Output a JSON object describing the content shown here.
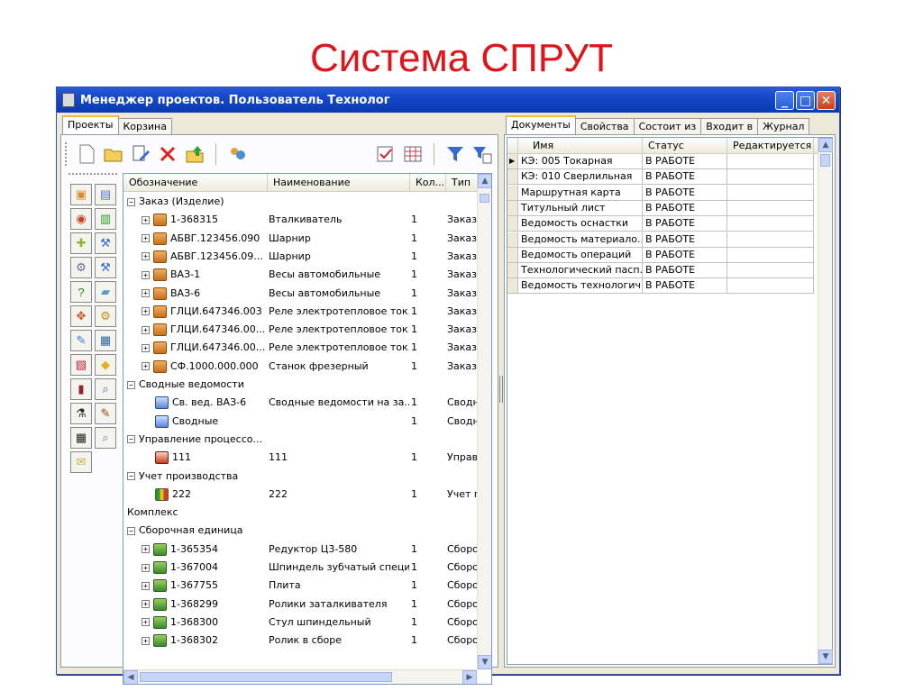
{
  "slide_title": "Система СПРУТ",
  "window": {
    "title": "Менеджер проектов. Пользователь Технолог",
    "buttons": [
      "_",
      "□",
      "✕"
    ]
  },
  "left_tabs": [
    "Проекты",
    "Корзина"
  ],
  "right_tabs": [
    "Документы",
    "Свойства",
    "Состоит из",
    "Входит в",
    "Журнал"
  ],
  "toolbar_icons": [
    "new-icon",
    "open-icon",
    "edit-icon",
    "delete-icon",
    "move-up-icon",
    "users-icon",
    "check-icon",
    "table-icon",
    "filter-icon",
    "filter-settings-icon"
  ],
  "side_icons": [
    "order-icon",
    "summary-icon",
    "process-icon",
    "production-icon",
    "assembly-icon",
    "part-icon",
    "gear-icon",
    "tool-icon",
    "help-icon",
    "material-icon",
    "equipment-icon",
    "settings-icon",
    "edit-doc-icon",
    "machine-icon",
    "report-icon",
    "color-icon",
    "print-icon",
    "view-icon",
    "wizard-icon",
    "paint-icon",
    "database-icon",
    "find-icon",
    "note-icon"
  ],
  "tree_columns": [
    "Обозначение",
    "Наименование",
    "Кол...",
    "Тип"
  ],
  "tree_rows": [
    {
      "level": 0,
      "exp": "⊟",
      "icon": "",
      "name": "Заказ (Изделие)",
      "title": "",
      "qty": "",
      "type": ""
    },
    {
      "level": 1,
      "exp": "⊞",
      "icon": "bag",
      "name": "1-368315",
      "title": "Вталкиватель",
      "qty": "1",
      "type": "Заказ ("
    },
    {
      "level": 1,
      "exp": "⊞",
      "icon": "bag",
      "name": "АБВГ.123456.090",
      "title": "Шарнир",
      "qty": "1",
      "type": "Заказ ("
    },
    {
      "level": 1,
      "exp": "⊞",
      "icon": "bag",
      "name": "АБВГ.123456.09...",
      "title": "Шарнир",
      "qty": "1",
      "type": "Заказ ("
    },
    {
      "level": 1,
      "exp": "⊞",
      "icon": "bag",
      "name": "ВАЗ-1",
      "title": "Весы автомобильные",
      "qty": "1",
      "type": "Заказ ("
    },
    {
      "level": 1,
      "exp": "⊞",
      "icon": "bag",
      "name": "ВАЗ-6",
      "title": "Весы автомобильные",
      "qty": "1",
      "type": "Заказ ("
    },
    {
      "level": 1,
      "exp": "⊞",
      "icon": "bag",
      "name": "ГЛЦИ.647346.003",
      "title": "Реле электротепловое ток...",
      "qty": "1",
      "type": "Заказ ("
    },
    {
      "level": 1,
      "exp": "⊞",
      "icon": "bag",
      "name": "ГЛЦИ.647346.00...",
      "title": "Реле электротепловое ток...",
      "qty": "1",
      "type": "Заказ ("
    },
    {
      "level": 1,
      "exp": "⊞",
      "icon": "bag",
      "name": "ГЛЦИ.647346.00...",
      "title": "Реле электротепловое ток...",
      "qty": "1",
      "type": "Заказ ("
    },
    {
      "level": 1,
      "exp": "⊞",
      "icon": "bag",
      "name": "СФ.1000.000.000",
      "title": "Станок фрезерный",
      "qty": "1",
      "type": "Заказ ("
    },
    {
      "level": 0,
      "exp": "⊟",
      "icon": "",
      "name": "Сводные ведомости",
      "title": "",
      "qty": "",
      "type": ""
    },
    {
      "level": 1,
      "exp": "",
      "icon": "stack",
      "name": "Св. вед. ВАЗ-6",
      "title": "Сводные ведомости на за...",
      "qty": "1",
      "type": "Сводн"
    },
    {
      "level": 1,
      "exp": "",
      "icon": "stack",
      "name": "Сводные",
      "title": "",
      "qty": "1",
      "type": "Сводн"
    },
    {
      "level": 0,
      "exp": "⊟",
      "icon": "",
      "name": "Управление процессо...",
      "title": "",
      "qty": "",
      "type": ""
    },
    {
      "level": 1,
      "exp": "",
      "icon": "proc",
      "name": "111",
      "title": "111",
      "qty": "1",
      "type": "Управ"
    },
    {
      "level": 0,
      "exp": "⊟",
      "icon": "",
      "name": "Учет производства",
      "title": "",
      "qty": "",
      "type": ""
    },
    {
      "level": 1,
      "exp": "",
      "icon": "bars",
      "name": "222",
      "title": "222",
      "qty": "1",
      "type": "Учет пр"
    },
    {
      "level": 0,
      "exp": "",
      "icon": "",
      "name": "Комплекс",
      "title": "",
      "qty": "",
      "type": ""
    },
    {
      "level": 0,
      "exp": "⊟",
      "icon": "",
      "name": "Сборочная единица",
      "title": "",
      "qty": "",
      "type": ""
    },
    {
      "level": 1,
      "exp": "⊞",
      "icon": "asm",
      "name": "1-365354",
      "title": "Редуктор Ц3-580",
      "qty": "1",
      "type": "Сборочн"
    },
    {
      "level": 1,
      "exp": "⊞",
      "icon": "asm",
      "name": "1-367004",
      "title": "Шпиндель зубчатый специ...",
      "qty": "1",
      "type": "Сборочн"
    },
    {
      "level": 1,
      "exp": "⊞",
      "icon": "asm",
      "name": "1-367755",
      "title": "Плита",
      "qty": "1",
      "type": "Сборочн"
    },
    {
      "level": 1,
      "exp": "⊞",
      "icon": "asm",
      "name": "1-368299",
      "title": "Ролики заталкивателя",
      "qty": "1",
      "type": "Сборочн"
    },
    {
      "level": 1,
      "exp": "⊞",
      "icon": "asm",
      "name": "1-368300",
      "title": "Стул шпиндельный",
      "qty": "1",
      "type": "Сборочн"
    },
    {
      "level": 1,
      "exp": "⊞",
      "icon": "asm",
      "name": "1-368302",
      "title": "Ролик в сборе",
      "qty": "1",
      "type": "Сборочн"
    }
  ],
  "doc_columns": [
    "Имя",
    "Статус",
    "Редактируется"
  ],
  "doc_rows": [
    {
      "name": "КЭ: 005 Токарная",
      "status": "В РАБОТЕ",
      "editing": "",
      "current": true
    },
    {
      "name": "КЭ: 010 Сверлильная",
      "status": "В РАБОТЕ",
      "editing": "",
      "current": false
    },
    {
      "name": "Маршрутная карта",
      "status": "В РАБОТЕ",
      "editing": "",
      "current": false
    },
    {
      "name": "Титульный лист",
      "status": "В РАБОТЕ",
      "editing": "",
      "current": false
    },
    {
      "name": "Ведомость оснастки",
      "status": "В РАБОТЕ",
      "editing": "",
      "current": false
    },
    {
      "name": "Ведомость материало...",
      "status": "В РАБОТЕ",
      "editing": "",
      "current": false
    },
    {
      "name": "Ведомость операций",
      "status": "В РАБОТЕ",
      "editing": "",
      "current": false
    },
    {
      "name": "Технологический пасп...",
      "status": "В РАБОТЕ",
      "editing": "",
      "current": false
    },
    {
      "name": "Ведомость технологич...",
      "status": "В РАБОТЕ",
      "editing": "",
      "current": false
    }
  ]
}
